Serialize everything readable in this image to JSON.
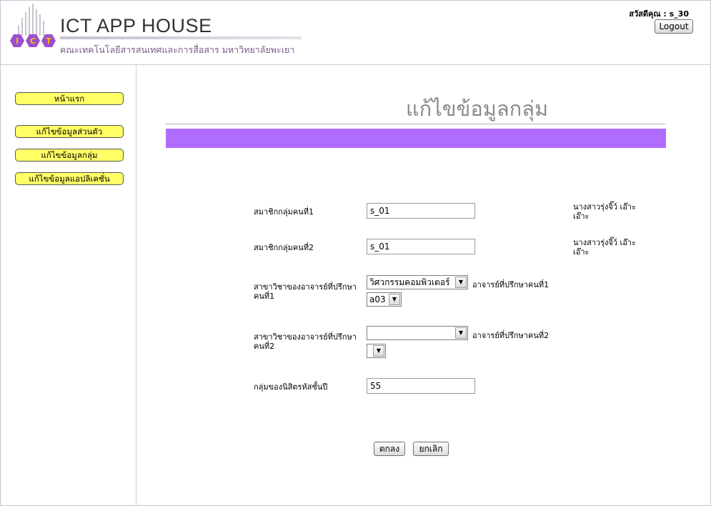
{
  "header": {
    "logo_text": "ICT",
    "site_title": "ICT APP HOUSE",
    "site_subtitle": "คณะเทคโนโลยีสารสนเทศและการสื่อสาร มหาวิทยาลัยพะเยา",
    "greeting": "สวัสดีคุณ : s_30",
    "logout_label": "Logout"
  },
  "sidebar": {
    "items": [
      {
        "label": "หน้าแรก"
      },
      {
        "label": "แก้ไขข้อมูลส่วนตัว"
      },
      {
        "label": "แก้ไขข้อมูลกลุ่ม"
      },
      {
        "label": "แก้ไขข้อมูลแอปลิเคชั่น"
      }
    ]
  },
  "main": {
    "title": "แก้ไขข้อมูลกลุ่ม",
    "band_color": "#b06cff",
    "member1": {
      "label": "สมาชิกกลุ่มคนที่1",
      "value": "s_01",
      "name": "นางสาวรุ่งจิ๊ว์ เอ๊าะ เอ๊าะ"
    },
    "member2": {
      "label": "สมาชิกกลุ่มคนที่2",
      "value": "s_01",
      "name": "นางสาวรุ่งจิ๊ว์ เอ๊าะ เอ๊าะ"
    },
    "advisor1": {
      "label": "สาขาวิชาของอาจารย์ที่ปรึกษาคนที่1",
      "department": "วิศวกรรมคอมพิวเตอร์",
      "advisor_label": "อาจารย์ที่ปรึกษาคนที่1",
      "advisor_value": "a03"
    },
    "advisor2": {
      "label": "สาขาวิชาของอาจารย์ที่ปรึกษาคนที่2",
      "department": "",
      "advisor_label": "อาจารย์ที่ปรึกษาคนที่2",
      "advisor_value": ""
    },
    "group": {
      "label": "กลุ่มของนิสิตรหัสชั้นปี",
      "value": "55"
    },
    "ok_label": "ตกลง",
    "cancel_label": "ยกเลิก"
  }
}
